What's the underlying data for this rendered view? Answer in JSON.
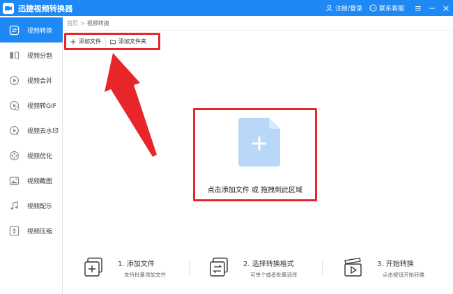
{
  "titlebar": {
    "title": "迅捷视频转换器",
    "register_login": "注册/登录",
    "contact_support": "联系客服"
  },
  "sidebar": {
    "items": [
      {
        "label": "视频转换",
        "icon": "convert-icon",
        "active": true
      },
      {
        "label": "视频分割",
        "icon": "split-icon",
        "active": false
      },
      {
        "label": "视频合并",
        "icon": "merge-icon",
        "active": false
      },
      {
        "label": "视频转GIF",
        "icon": "gif-icon",
        "active": false
      },
      {
        "label": "视频去水印",
        "icon": "watermark-icon",
        "active": false
      },
      {
        "label": "视频优化",
        "icon": "optimize-icon",
        "active": false
      },
      {
        "label": "视频截图",
        "icon": "screenshot-icon",
        "active": false
      },
      {
        "label": "视频配乐",
        "icon": "music-icon",
        "active": false
      },
      {
        "label": "视频压缩",
        "icon": "compress-icon",
        "active": false
      }
    ]
  },
  "breadcrumb": {
    "home": "首页",
    "separator": ">",
    "current": "视频转换"
  },
  "toolbar": {
    "add_file": "添加文件",
    "add_folder": "添加文件夹"
  },
  "dropzone": {
    "text": "点击添加文件 或 拖拽到此区域"
  },
  "steps": [
    {
      "title": "1. 添加文件",
      "subtitle": "支持批量添加文件"
    },
    {
      "title": "2. 选择转换格式",
      "subtitle": "可单个或者批量选择"
    },
    {
      "title": "3. 开始转换",
      "subtitle": "点击按钮开始转换"
    }
  ],
  "colors": {
    "primary": "#1e88f5",
    "highlight": "#e8262a",
    "file_icon": "#b8d7f9"
  }
}
